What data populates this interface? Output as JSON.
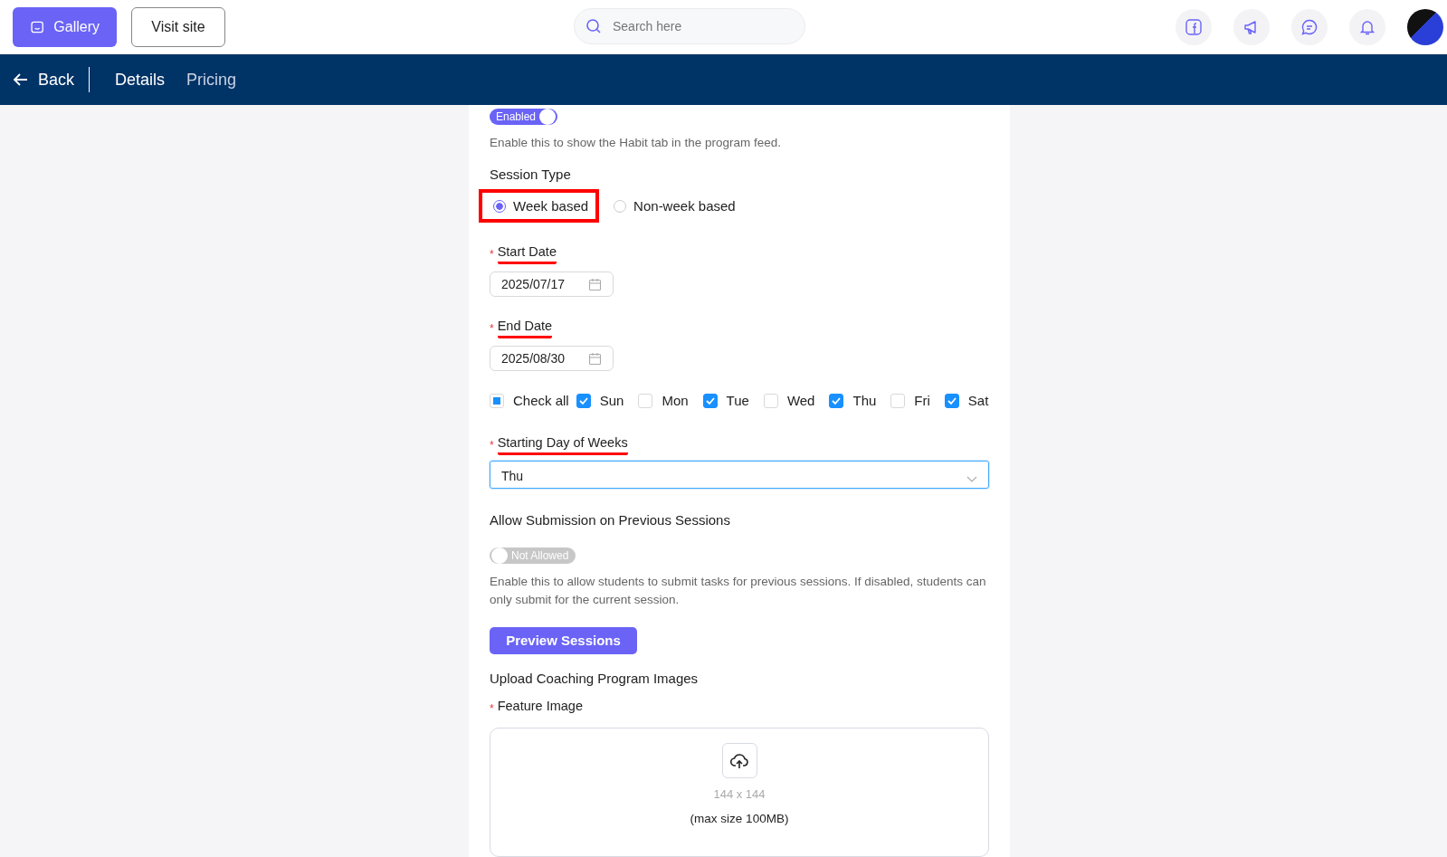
{
  "topbar": {
    "buttons": [
      {
        "label": "Gallery",
        "kind": "primary"
      },
      {
        "label": "Visit site",
        "kind": "outline"
      }
    ],
    "search": {
      "placeholder": "Search here"
    }
  },
  "nav": {
    "back": "Back",
    "tabs": [
      {
        "label": "Details",
        "selected": true
      },
      {
        "label": "Pricing",
        "selected": false
      }
    ]
  },
  "habit_toggle": {
    "label": "Enabled",
    "on": true,
    "help": "Enable this to show the Habit tab in the program feed."
  },
  "session_type": {
    "label": "Session Type",
    "options": [
      {
        "label": "Week based",
        "selected": true,
        "highlighted": true
      },
      {
        "label": "Non-week based",
        "selected": false,
        "highlighted": false
      }
    ]
  },
  "start_date": {
    "label": "Start Date",
    "required_mark": "*",
    "underlined": true,
    "value": "2025/07/17"
  },
  "end_date": {
    "label": "End Date",
    "required_mark": "*",
    "underlined": true,
    "value": "2025/08/30"
  },
  "days": {
    "check_all": {
      "label": "Check all",
      "checked": false,
      "indeterminate": true
    },
    "items": [
      {
        "label": "Sun",
        "checked": true
      },
      {
        "label": "Mon",
        "checked": false
      },
      {
        "label": "Tue",
        "checked": true
      },
      {
        "label": "Wed",
        "checked": false
      },
      {
        "label": "Thu",
        "checked": true
      },
      {
        "label": "Fri",
        "checked": false
      },
      {
        "label": "Sat",
        "checked": true
      }
    ]
  },
  "starting_day": {
    "label": "Starting Day of Weeks",
    "required_mark": "*",
    "underlined": true,
    "value": "Thu"
  },
  "previous_sessions": {
    "label": "Allow Submission on Previous Sessions",
    "toggle_label": "Not Allowed",
    "on": false,
    "help": "Enable this to allow students to submit tasks for previous sessions. If disabled, students can only submit for the current session."
  },
  "preview_button": "Preview Sessions",
  "upload": {
    "title": "Upload Coaching Program Images",
    "label": "Feature Image",
    "required_mark": "*",
    "size": "144 x 144",
    "max": "(max size 100MB)"
  }
}
